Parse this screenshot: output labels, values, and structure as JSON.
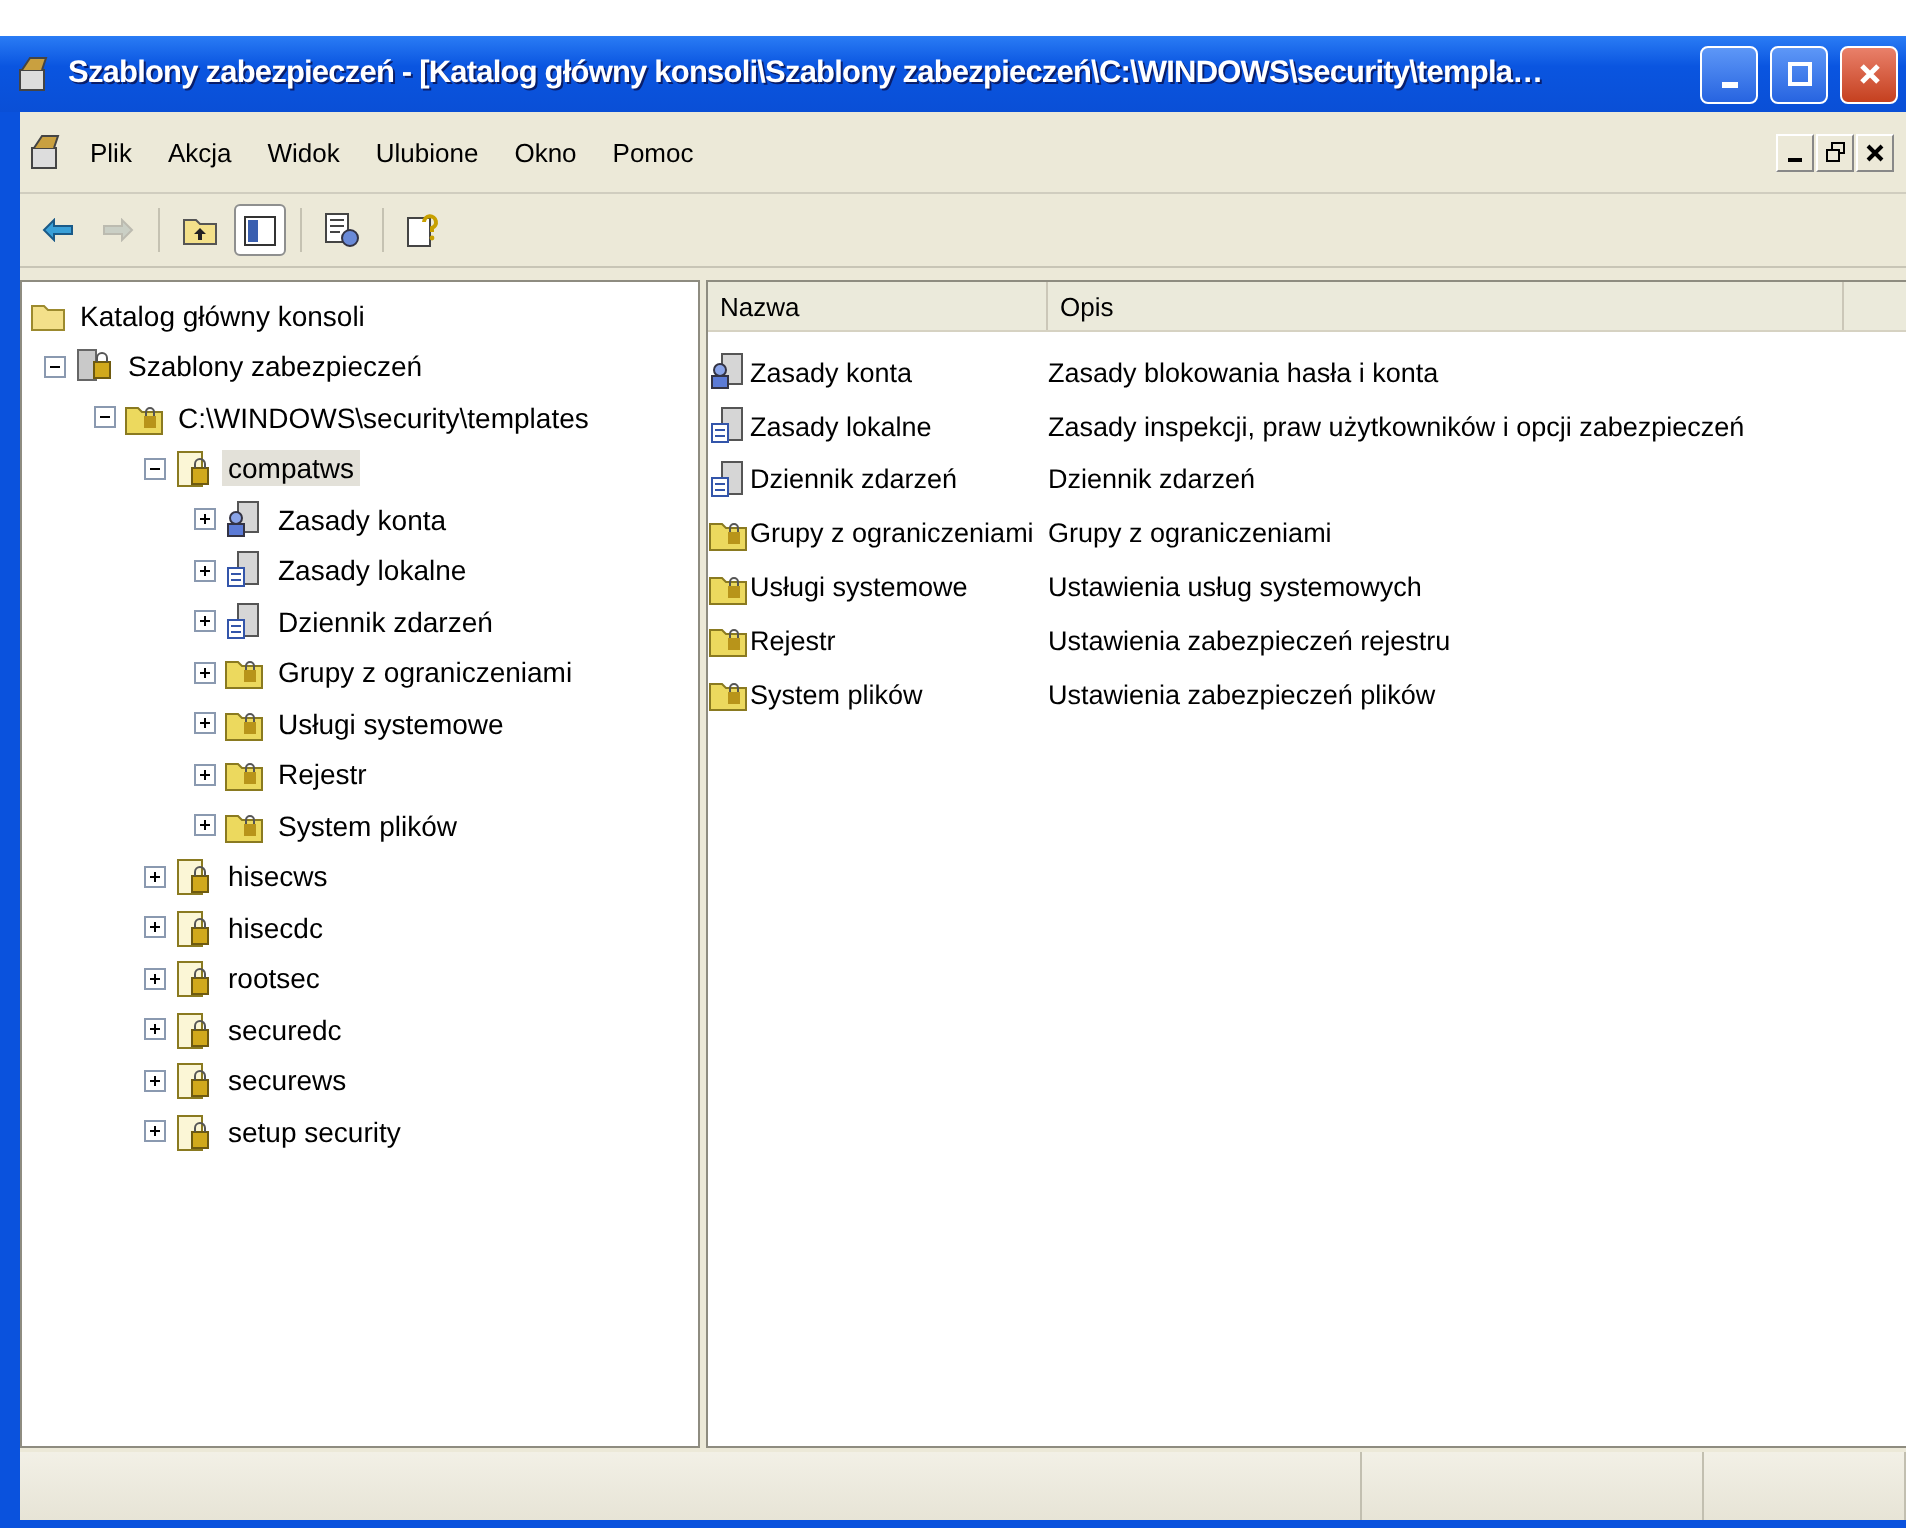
{
  "window": {
    "title": "Szablony zabezpieczeń - [Katalog główny konsoli\\Szablony zabezpieczeń\\C:\\WINDOWS\\security\\templa…"
  },
  "menu": [
    {
      "label": "Plik"
    },
    {
      "label": "Akcja"
    },
    {
      "label": "Widok"
    },
    {
      "label": "Ulubione"
    },
    {
      "label": "Okno"
    },
    {
      "label": "Pomoc"
    }
  ],
  "toolbar": [
    {
      "kind": "back",
      "disabled": false,
      "pressed": false
    },
    {
      "kind": "forward",
      "disabled": true,
      "pressed": false
    },
    {
      "kind": "up",
      "disabled": false,
      "pressed": false
    },
    {
      "kind": "tree",
      "disabled": false,
      "pressed": true
    },
    {
      "kind": "export",
      "disabled": false,
      "pressed": false
    },
    {
      "kind": "help",
      "disabled": false,
      "pressed": false
    }
  ],
  "tree": [
    {
      "label": "Katalog główny konsoli",
      "kind": "folder",
      "selected": false,
      "children": [
        {
          "label": "Szablony zabezpieczeń",
          "kind": "snapin",
          "expanded": true,
          "selected": false,
          "children": [
            {
              "label": "C:\\WINDOWS\\security\\templates",
              "kind": "lockfolder",
              "expanded": true,
              "selected": false,
              "children": [
                {
                  "label": "compatws",
                  "kind": "template",
                  "expanded": true,
                  "selected": true,
                  "children": [
                    {
                      "label": "Zasady konta",
                      "kind": "users",
                      "expanded": false,
                      "selected": false
                    },
                    {
                      "label": "Zasady lokalne",
                      "kind": "server",
                      "expanded": false,
                      "selected": false
                    },
                    {
                      "label": "Dziennik zdarzeń",
                      "kind": "server",
                      "expanded": false,
                      "selected": false
                    },
                    {
                      "label": "Grupy z ograniczeniami",
                      "kind": "lockfolder",
                      "expanded": false,
                      "selected": false
                    },
                    {
                      "label": "Usługi systemowe",
                      "kind": "lockfolder",
                      "expanded": false,
                      "selected": false
                    },
                    {
                      "label": "Rejestr",
                      "kind": "lockfolder",
                      "expanded": false,
                      "selected": false
                    },
                    {
                      "label": "System plików",
                      "kind": "lockfolder",
                      "expanded": false,
                      "selected": false
                    }
                  ]
                },
                {
                  "label": "hisecws",
                  "kind": "template",
                  "expanded": false,
                  "selected": false
                },
                {
                  "label": "hisecdc",
                  "kind": "template",
                  "expanded": false,
                  "selected": false
                },
                {
                  "label": "rootsec",
                  "kind": "template",
                  "expanded": false,
                  "selected": false
                },
                {
                  "label": "securedc",
                  "kind": "template",
                  "expanded": false,
                  "selected": false
                },
                {
                  "label": "securews",
                  "kind": "template",
                  "expanded": false,
                  "selected": false
                },
                {
                  "label": "setup security",
                  "kind": "template",
                  "expanded": false,
                  "selected": false
                }
              ]
            }
          ]
        }
      ]
    }
  ],
  "list": {
    "columns": [
      "Nazwa",
      "Opis"
    ],
    "rows": [
      {
        "kind": "users",
        "name": "Zasady konta",
        "description": "Zasady blokowania hasła i konta"
      },
      {
        "kind": "server",
        "name": "Zasady lokalne",
        "description": "Zasady inspekcji, praw użytkowników i opcji zabezpieczeń"
      },
      {
        "kind": "server",
        "name": "Dziennik zdarzeń",
        "description": "Dziennik zdarzeń"
      },
      {
        "kind": "lockfolder",
        "name": "Grupy z ograniczeniami",
        "description": "Grupy z ograniczeniami"
      },
      {
        "kind": "lockfolder",
        "name": "Usługi systemowe",
        "description": "Ustawienia usług systemowych"
      },
      {
        "kind": "lockfolder",
        "name": "Rejestr",
        "description": "Ustawienia zabezpieczeń rejestru"
      },
      {
        "kind": "lockfolder",
        "name": "System plików",
        "description": "Ustawienia zabezpieczeń plików"
      }
    ]
  }
}
